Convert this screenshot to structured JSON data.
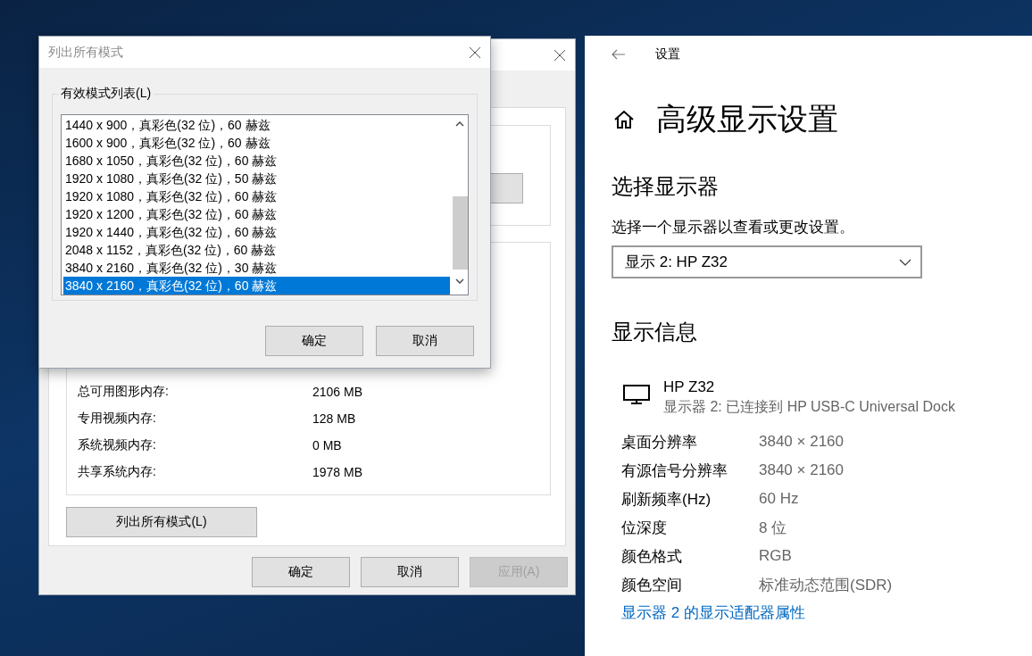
{
  "properties_window": {
    "memory_rows": [
      {
        "label": "总可用图形内存:",
        "value": "2106 MB"
      },
      {
        "label": "专用视频内存:",
        "value": "128 MB"
      },
      {
        "label": "系统视频内存:",
        "value": "0 MB"
      },
      {
        "label": "共享系统内存:",
        "value": "1978 MB"
      }
    ],
    "list_modes_button": "列出所有模式(L)",
    "buttons": [
      {
        "label": "确定",
        "disabled": false
      },
      {
        "label": "取消",
        "disabled": false
      },
      {
        "label": "应用(A)",
        "disabled": true
      }
    ]
  },
  "modes_dialog": {
    "title": "列出所有模式",
    "group_label": "有效模式列表(L)",
    "modes": [
      {
        "label": "1440 x 900，真彩色(32 位)，60 赫兹",
        "selected": false
      },
      {
        "label": "1600 x 900，真彩色(32 位)，60 赫兹",
        "selected": false
      },
      {
        "label": "1680 x 1050，真彩色(32 位)，60 赫兹",
        "selected": false
      },
      {
        "label": "1920 x 1080，真彩色(32 位)，50 赫兹",
        "selected": false
      },
      {
        "label": "1920 x 1080，真彩色(32 位)，60 赫兹",
        "selected": false
      },
      {
        "label": "1920 x 1200，真彩色(32 位)，60 赫兹",
        "selected": false
      },
      {
        "label": "1920 x 1440，真彩色(32 位)，60 赫兹",
        "selected": false
      },
      {
        "label": "2048 x 1152，真彩色(32 位)，60 赫兹",
        "selected": false
      },
      {
        "label": "3840 x 2160，真彩色(32 位)，30 赫兹",
        "selected": false
      },
      {
        "label": "3840 x 2160，真彩色(32 位)，60 赫兹",
        "selected": true
      }
    ],
    "buttons": [
      "确定",
      "取消"
    ]
  },
  "settings": {
    "header": "设置",
    "title": "高级显示设置",
    "select_heading": "选择显示器",
    "select_description": "选择一个显示器以查看或更改设置。",
    "display_dropdown": {
      "value": "显示 2: HP Z32"
    },
    "info_heading": "显示信息",
    "monitor": {
      "name": "HP Z32",
      "connection": "显示器 2: 已连接到 HP USB-C Universal Dock"
    },
    "info_rows": [
      {
        "label": "桌面分辨率",
        "value": "3840 × 2160"
      },
      {
        "label": "有源信号分辨率",
        "value": "3840 × 2160"
      },
      {
        "label": "刷新频率(Hz)",
        "value": "60 Hz"
      },
      {
        "label": "位深度",
        "value": "8 位"
      },
      {
        "label": "颜色格式",
        "value": "RGB"
      },
      {
        "label": "颜色空间",
        "value": "标准动态范围(SDR)"
      }
    ],
    "adapter_link": "显示器 2 的显示适配器属性"
  }
}
